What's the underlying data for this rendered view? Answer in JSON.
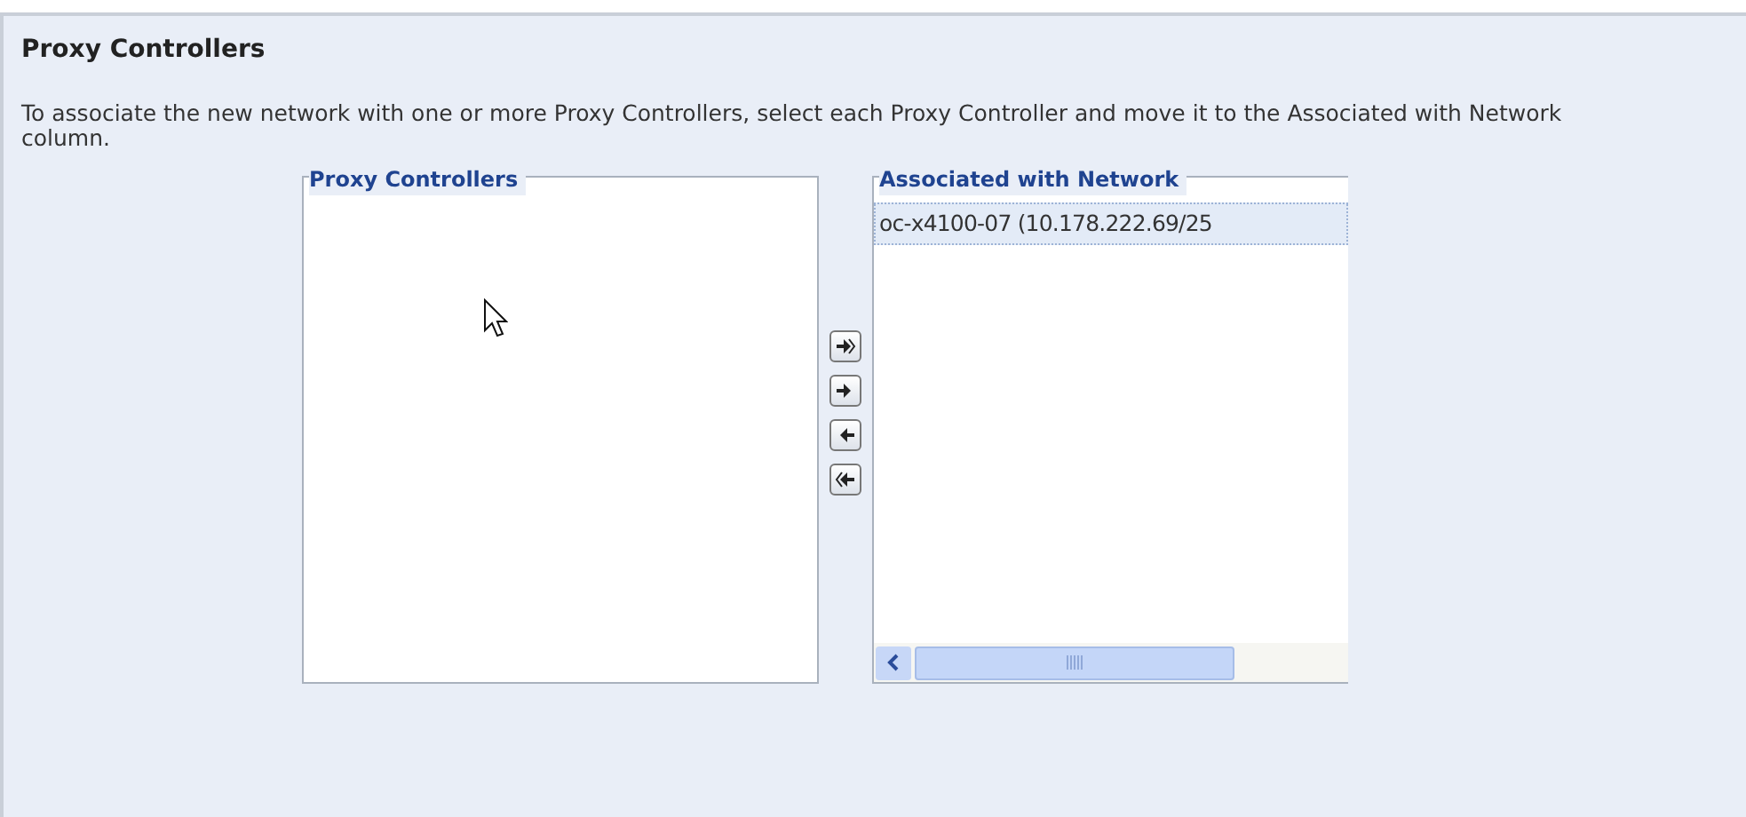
{
  "title": "Proxy Controllers",
  "instructions": "To associate the new network with one or more Proxy Controllers, select each Proxy Controller and move it to the Associated with Network column.",
  "available": {
    "label": "Proxy Controllers"
  },
  "buttons": [
    {
      "kind": "move_all_right"
    },
    {
      "kind": "move_right"
    },
    {
      "kind": "move_left"
    },
    {
      "kind": "move_all_left"
    }
  ],
  "associated": {
    "label": "Associated with Network",
    "items": [
      {
        "text": "oc-x4100-07 (10.178.222.69/25",
        "selected": true
      }
    ]
  }
}
